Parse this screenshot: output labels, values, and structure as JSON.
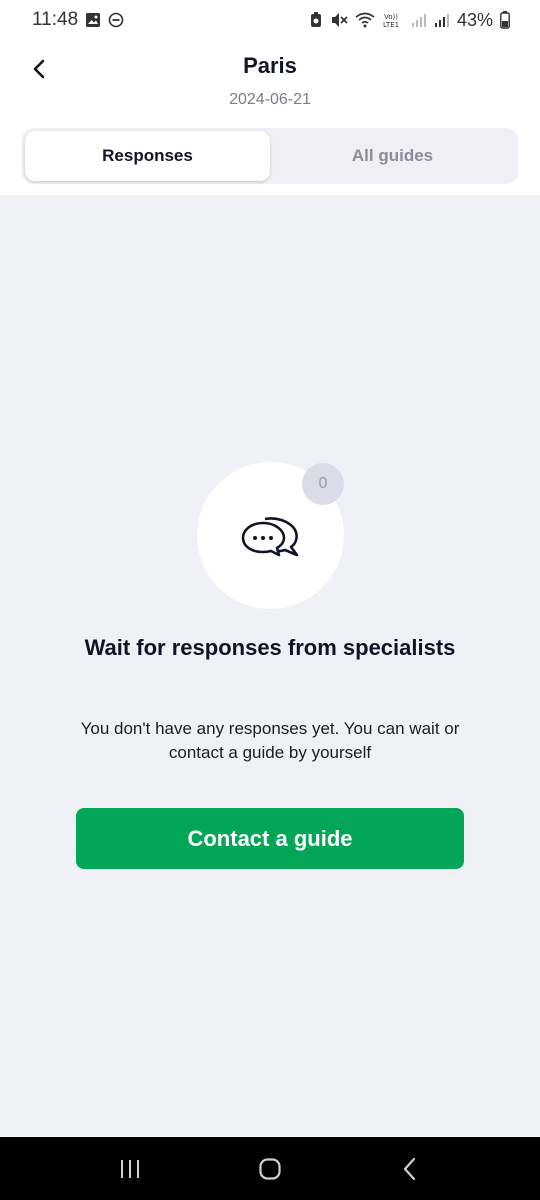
{
  "status_bar": {
    "time": "11:48",
    "battery_percent": "43%",
    "icons_left": [
      "gallery-icon",
      "dnd-icon"
    ],
    "icons_right": [
      "alarm-icon",
      "mute-icon",
      "wifi-icon",
      "volte-icon",
      "signal-icon",
      "signal-icon",
      "battery-icon"
    ]
  },
  "header": {
    "title": "Paris",
    "date": "2024-06-21"
  },
  "tabs": [
    {
      "label": "Responses",
      "active": true
    },
    {
      "label": "All guides",
      "active": false
    }
  ],
  "empty_state": {
    "badge_count": "0",
    "title": "Wait for responses from specialists",
    "description": "You don't have any responses yet. You can wait or contact a guide by yourself",
    "cta_label": "Contact a guide"
  },
  "colors": {
    "accent": "#03a657",
    "background": "#f0f0f7",
    "text_primary": "#111426",
    "text_secondary": "#7a7d88"
  }
}
